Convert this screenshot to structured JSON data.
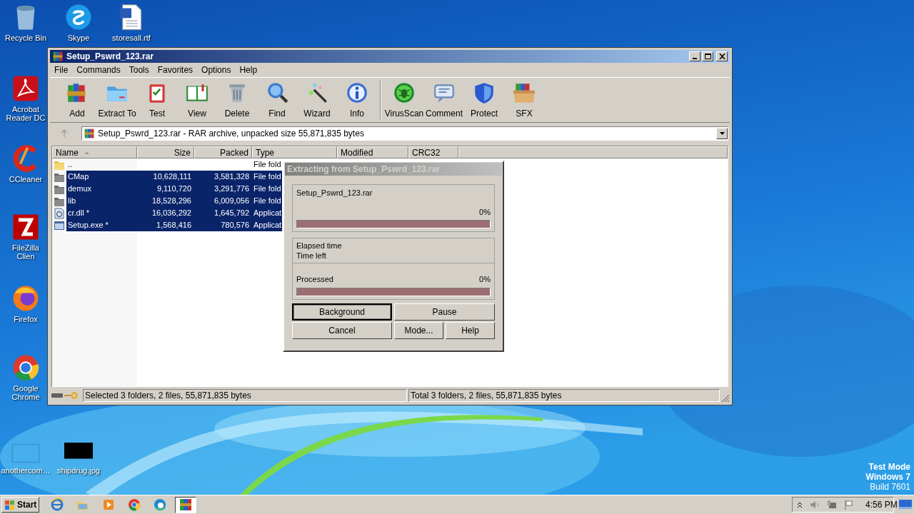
{
  "desktop": {
    "icons": [
      {
        "label": "Recycle Bin"
      },
      {
        "label": "Skype"
      },
      {
        "label": "storesall.rtf"
      },
      {
        "label": "Acrobat Reader DC"
      },
      {
        "label": "CCleaner"
      },
      {
        "label": "FileZilla Clien"
      },
      {
        "label": "Firefox"
      },
      {
        "label": "Google Chrome"
      },
      {
        "label": "anothercom…"
      },
      {
        "label": "shipdrug.jpg"
      }
    ],
    "os_notice": [
      "Test Mode",
      "Windows 7",
      "Build 7601"
    ]
  },
  "window": {
    "title": "Setup_Pswrd_123.rar",
    "active": true,
    "menu": [
      "File",
      "Commands",
      "Tools",
      "Favorites",
      "Options",
      "Help"
    ],
    "toolbar": {
      "groups": [
        [
          "Add",
          "Extract To",
          "Test",
          "View",
          "Delete",
          "Find",
          "Wizard",
          "Info"
        ],
        [
          "VirusScan",
          "Comment",
          "Protect",
          "SFX"
        ]
      ]
    },
    "up_button": {
      "disabled": true
    },
    "address": "Setup_Pswrd_123.rar - RAR archive, unpacked size 55,871,835 bytes",
    "columns": [
      {
        "label": "Name",
        "sorted": true
      },
      {
        "label": "Size",
        "sorted": false
      },
      {
        "label": "Packed",
        "sorted": false
      },
      {
        "label": "Type",
        "sorted": false
      },
      {
        "label": "Modified",
        "sorted": false
      },
      {
        "label": "CRC32",
        "sorted": false
      }
    ],
    "rows": [
      {
        "kind": "parent",
        "name": "..",
        "type": "File fold",
        "selected": false
      },
      {
        "kind": "folder",
        "name": "CMap",
        "size": "10,628,111",
        "packed": "3,581,328",
        "type": "File fold",
        "selected": true
      },
      {
        "kind": "folder",
        "name": "demux",
        "size": "9,110,720",
        "packed": "3,291,776",
        "type": "File fold",
        "selected": true
      },
      {
        "kind": "folder",
        "name": "lib",
        "size": "18,528,296",
        "packed": "6,009,056",
        "type": "File fold",
        "selected": true
      },
      {
        "kind": "library",
        "name": "cr.dll *",
        "size": "16,036,292",
        "packed": "1,645,792",
        "type": "Applicat",
        "selected": true
      },
      {
        "kind": "program",
        "name": "Setup.exe *",
        "size": "1,568,416",
        "packed": "780,576",
        "type": "Applicat",
        "selected": true
      }
    ],
    "status": {
      "selection": "Selected 3 folders, 2 files, 55,871,835 bytes",
      "total": "Total 3 folders, 2 files, 55,871,835 bytes"
    }
  },
  "dialog": {
    "title": "Extracting from Setup_Pswrd_123.rar",
    "active": false,
    "file_progress": {
      "label": "Setup_Pswrd_123.rar",
      "percent": "0%",
      "level": 0
    },
    "times": [
      "Elapsed time",
      "Time left"
    ],
    "total_progress": {
      "label": "Processed",
      "percent": "0%",
      "level": 0
    },
    "buttons": [
      {
        "label": "Background",
        "default": true
      },
      {
        "label": "Pause",
        "default": false
      },
      {
        "label": "Cancel",
        "default": false
      },
      {
        "label": "Mode...",
        "default": false
      },
      {
        "label": "Help",
        "default": false
      }
    ]
  },
  "taskbar": {
    "start": "Start",
    "apps": [
      {
        "selected": false
      },
      {
        "selected": false
      },
      {
        "selected": false
      },
      {
        "selected": false
      },
      {
        "selected": false
      },
      {
        "selected": true
      }
    ],
    "time": "4:56 PM"
  }
}
